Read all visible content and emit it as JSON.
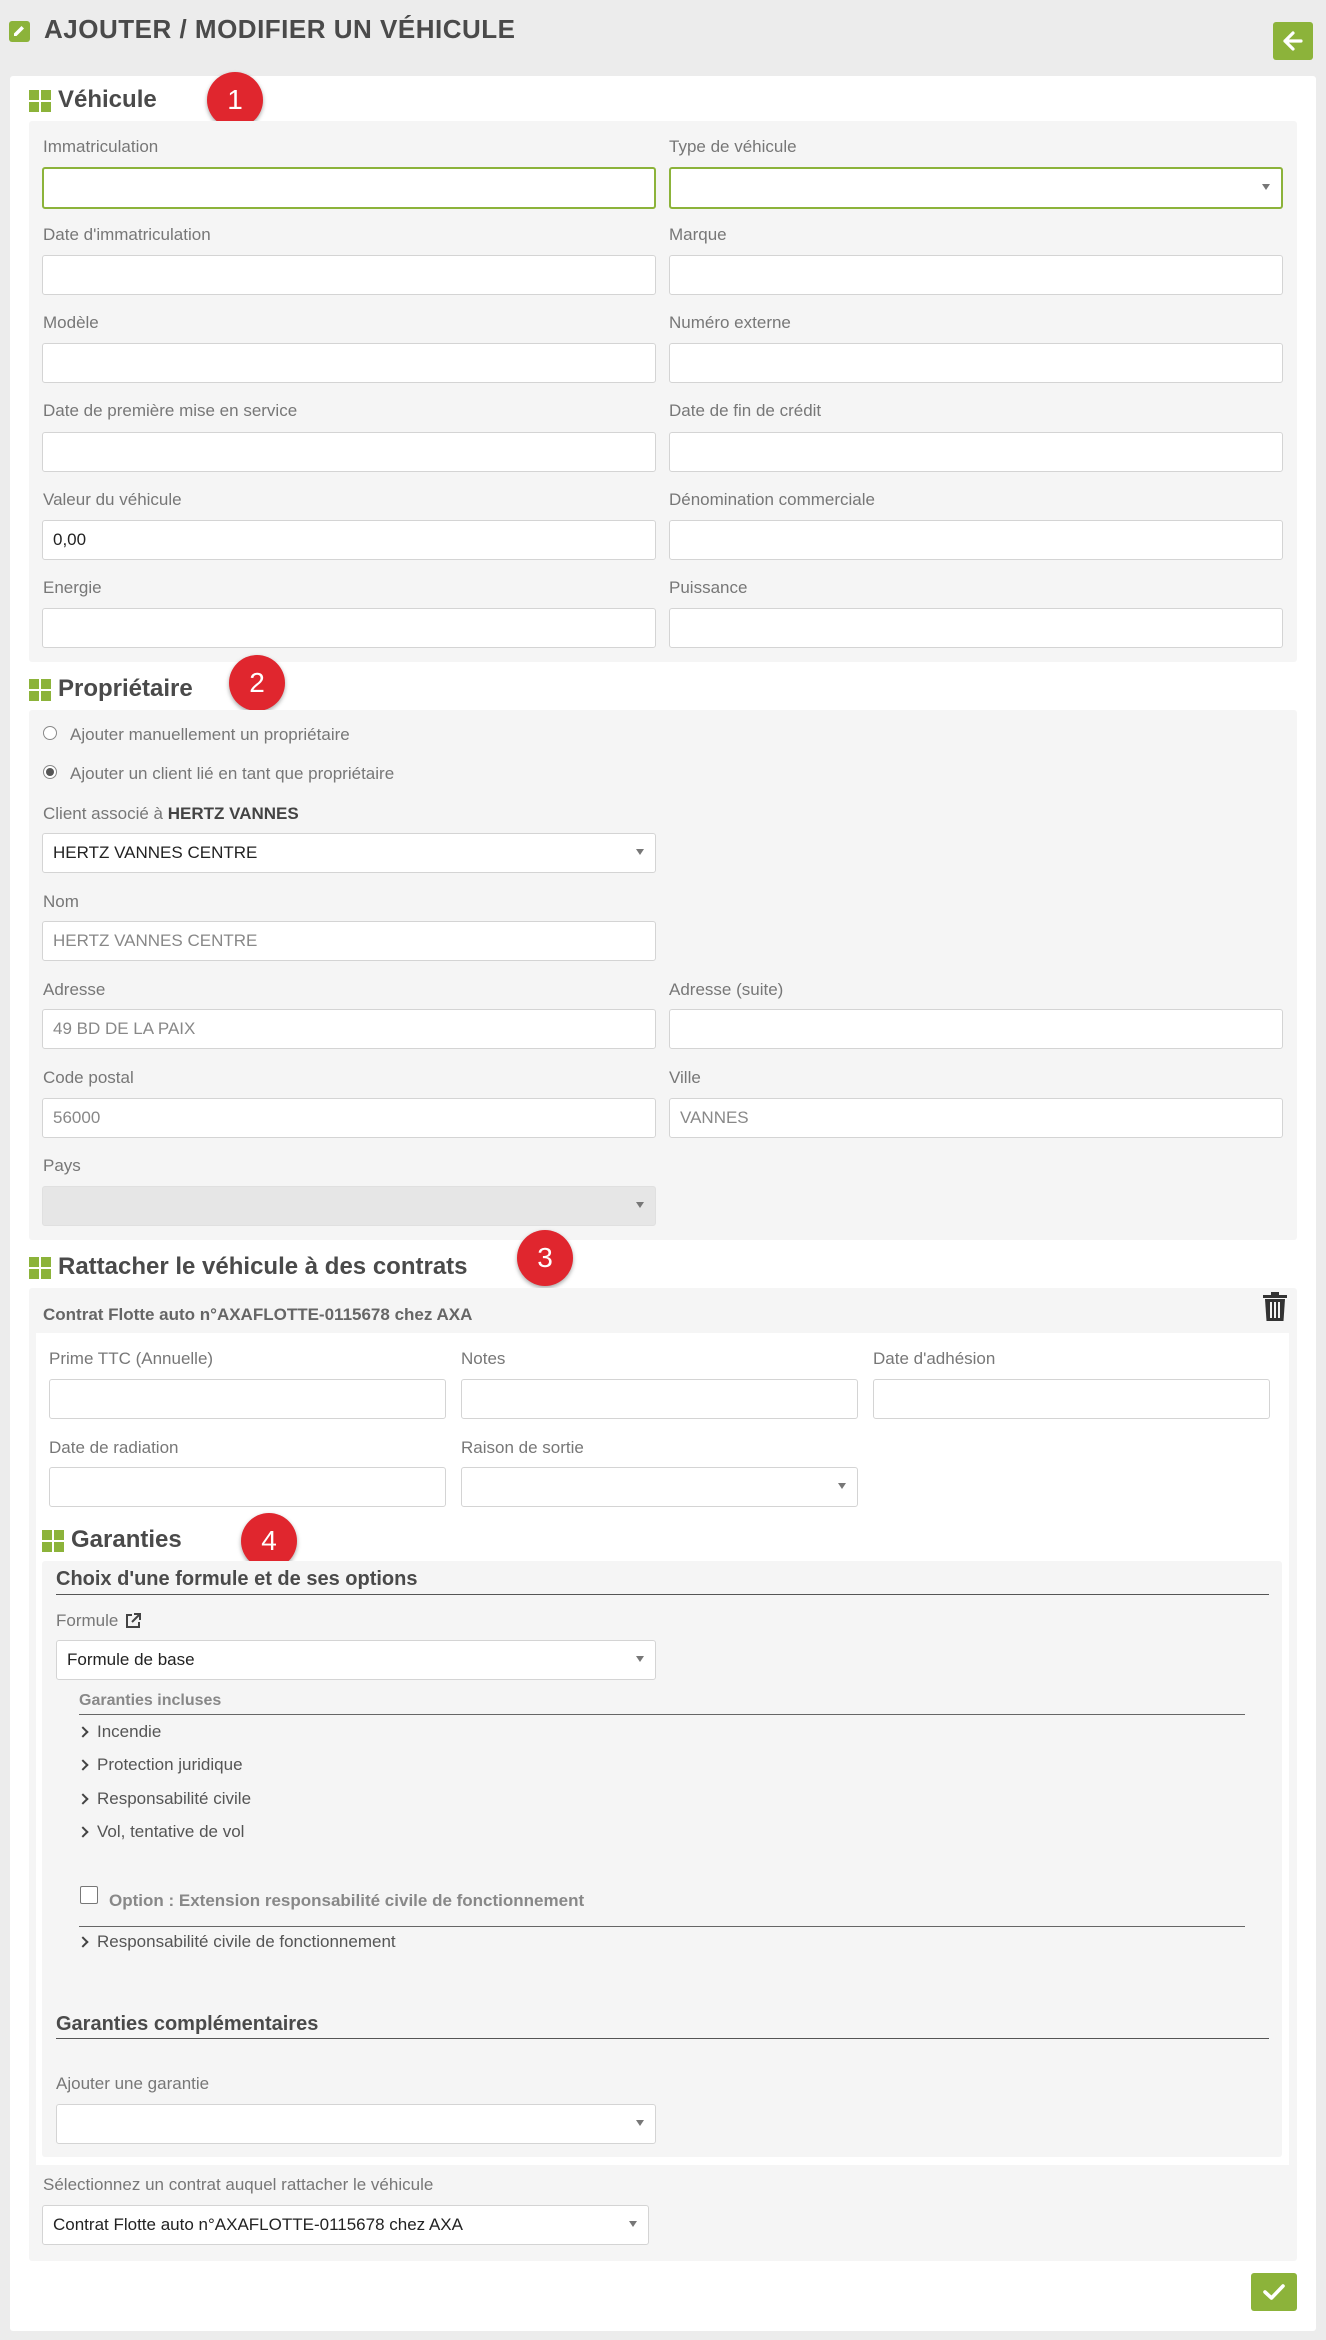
{
  "page": {
    "title": "AJOUTER / MODIFIER UN VÉHICULE",
    "accent": "#8cb33a",
    "badge_color": "#e0262e"
  },
  "badges": [
    "1",
    "2",
    "3",
    "4"
  ],
  "vehicule": {
    "title": "Véhicule",
    "immatriculation": {
      "label": "Immatriculation",
      "value": ""
    },
    "type_vehicule": {
      "label": "Type de véhicule",
      "value": ""
    },
    "date_immatriculation": {
      "label": "Date d'immatriculation",
      "value": ""
    },
    "marque": {
      "label": "Marque",
      "value": ""
    },
    "modele": {
      "label": "Modèle",
      "value": ""
    },
    "numero_externe": {
      "label": "Numéro externe",
      "value": ""
    },
    "date_premiere_mise": {
      "label": "Date de première mise en service",
      "value": ""
    },
    "date_fin_credit": {
      "label": "Date de fin de crédit",
      "value": ""
    },
    "valeur": {
      "label": "Valeur du véhicule",
      "value": "0,00"
    },
    "denomination": {
      "label": "Dénomination commerciale",
      "value": ""
    },
    "energie": {
      "label": "Energie",
      "value": ""
    },
    "puissance": {
      "label": "Puissance",
      "value": ""
    }
  },
  "proprietaire": {
    "title": "Propriétaire",
    "radio_manual": "Ajouter manuellement un propriétaire",
    "radio_client": "Ajouter un client lié en tant que propriétaire",
    "client_label_prefix": "Client associé à ",
    "client_label_bold": "HERTZ VANNES",
    "client_value": "HERTZ VANNES CENTRE",
    "nom": {
      "label": "Nom",
      "value": "HERTZ VANNES CENTRE"
    },
    "adresse": {
      "label": "Adresse",
      "value": "49  BD DE LA PAIX"
    },
    "adresse_suite": {
      "label": "Adresse (suite)",
      "value": ""
    },
    "code_postal": {
      "label": "Code postal",
      "value": "56000"
    },
    "ville": {
      "label": "Ville",
      "value": "VANNES"
    },
    "pays": {
      "label": "Pays",
      "value": ""
    }
  },
  "contrats": {
    "title": "Rattacher le véhicule à des contrats",
    "contract_title": "Contrat Flotte auto n°AXAFLOTTE-0115678 chez AXA",
    "prime": {
      "label": "Prime TTC (Annuelle)",
      "value": ""
    },
    "notes": {
      "label": "Notes",
      "value": ""
    },
    "date_adhesion": {
      "label": "Date d'adhésion",
      "value": ""
    },
    "date_radiation": {
      "label": "Date de radiation",
      "value": ""
    },
    "raison_sortie": {
      "label": "Raison de sortie",
      "value": ""
    },
    "select_label": "Sélectionnez un contrat auquel rattacher le véhicule",
    "select_value": "Contrat Flotte auto n°AXAFLOTTE-0115678 chez AXA"
  },
  "garanties": {
    "title": "Garanties",
    "choix_title": "Choix d'une formule et de ses options",
    "formule_label": "Formule",
    "formule_value": "Formule de base",
    "incluses_title": "Garanties incluses",
    "incluses": [
      "Incendie",
      "Protection juridique",
      "Responsabilité civile",
      "Vol, tentative de vol"
    ],
    "option_label": "Option : Extension responsabilité civile de fonctionnement",
    "option_items": [
      "Responsabilité civile de fonctionnement"
    ],
    "complementaires_title": "Garanties complémentaires",
    "ajouter_label": "Ajouter une garantie",
    "ajouter_value": ""
  }
}
